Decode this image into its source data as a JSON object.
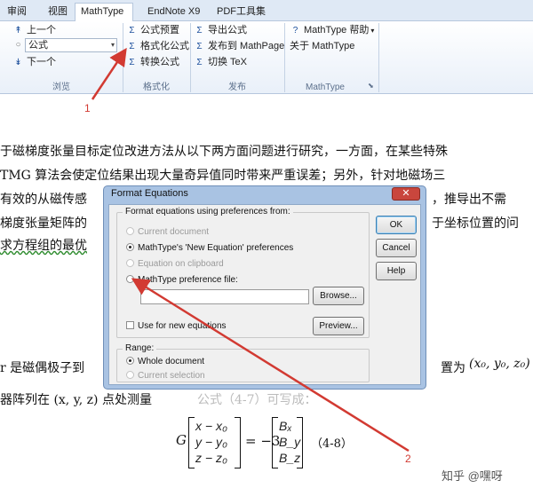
{
  "tabs": [
    "审阅",
    "视图",
    "MathType",
    "EndNote X9",
    "PDF工具集"
  ],
  "ribbon": {
    "browse": {
      "prev": "上一个",
      "combo": "公式",
      "next": "下一个",
      "group": "浏览"
    },
    "format": {
      "preset": "公式预置",
      "format": "格式化公式",
      "convert": "转换公式",
      "group": "格式化"
    },
    "publish": {
      "export": "导出公式",
      "publish": "发布到 MathPage",
      "tex": "切换 TeX",
      "group": "发布"
    },
    "mathtype": {
      "help": "MathType 帮助",
      "about": "关于 MathType",
      "group": "MathType"
    }
  },
  "doc": {
    "l1": "于磁梯度张量目标定位改进方法从以下两方面问题进行研究，一方面，在某些特殊",
    "l2": "TMG  算法会使定位结果出现大量奇异值同时带来严重误差；另外，针对地磁场三",
    "l3a": "有效的从磁传感",
    "l3b": "，推导出不需",
    "l4a": "梯度张量矩阵的",
    "l4b": "于坐标位置的问",
    "l5a": "求方程组的最优",
    "l6a": "r 是磁偶极子到",
    "l6b": "置为",
    "l6c": "(x₀, y₀, z₀)",
    "l7": "器阵列在 (x, y, z) 点处测量",
    "l7b": "公式（4-7）可写成："
  },
  "equation": {
    "lhs": "G",
    "col1": [
      "x − x₀",
      "y − y₀",
      "z − z₀"
    ],
    "mid": "= −3",
    "col2": [
      "Bₓ",
      "B_y",
      "B_z"
    ],
    "label": "（4-8）"
  },
  "dialog": {
    "title": "Format Equations",
    "close": "✕",
    "group1": "Format equations using preferences from:",
    "opt_current": "Current document",
    "opt_new": "MathType's 'New Equation' preferences",
    "opt_clip": "Equation on clipboard",
    "opt_file": "MathType preference file:",
    "browse": "Browse...",
    "use_new": "Use for new equations",
    "preview": "Preview...",
    "range": "Range:",
    "range_whole": "Whole document",
    "range_sel": "Current selection",
    "ok": "OK",
    "cancel": "Cancel",
    "help": "Help"
  },
  "annotations": {
    "n1": "1",
    "n2": "2"
  },
  "watermark": "知乎 @嘿呀",
  "colors": {
    "arrow": "#d23a32"
  }
}
